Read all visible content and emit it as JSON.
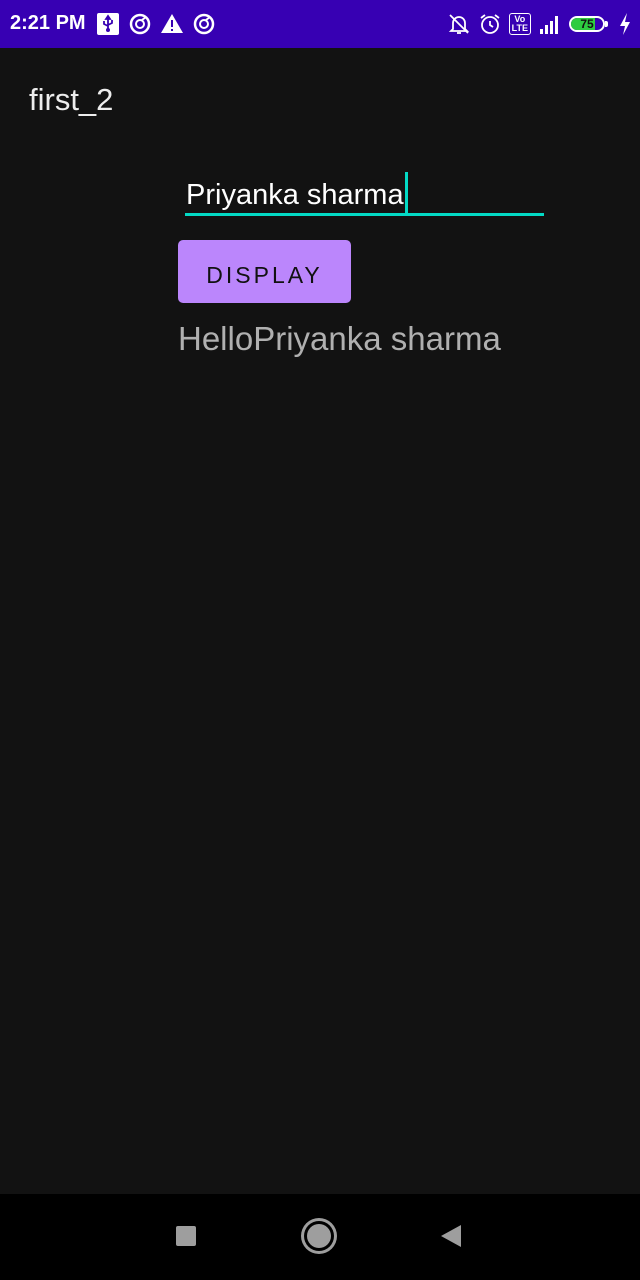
{
  "status_bar": {
    "time": "2:21 PM",
    "left_icons": [
      "usb-icon",
      "sync-circle-icon",
      "warning-icon",
      "sync-circle-icon"
    ],
    "right_icons": [
      "notifications-off-icon",
      "alarm-icon",
      "volte-icon",
      "signal-icon",
      "battery-icon",
      "charging-icon"
    ],
    "volte_label": "Vo\nLTE",
    "battery_level": "75",
    "battery_fraction": 0.75,
    "background_color": "#3700b3"
  },
  "app": {
    "title": "first_2",
    "background_color": "#121212",
    "accent_color": "#03dac5",
    "button_color": "#bb86fc"
  },
  "form": {
    "name_value": "Priyanka sharma",
    "display_button_label": "DISPLAY",
    "output_text": "HelloPriyanka sharma"
  },
  "nav_bar": {
    "icons": [
      "recent-apps-icon",
      "home-icon",
      "back-icon"
    ]
  }
}
